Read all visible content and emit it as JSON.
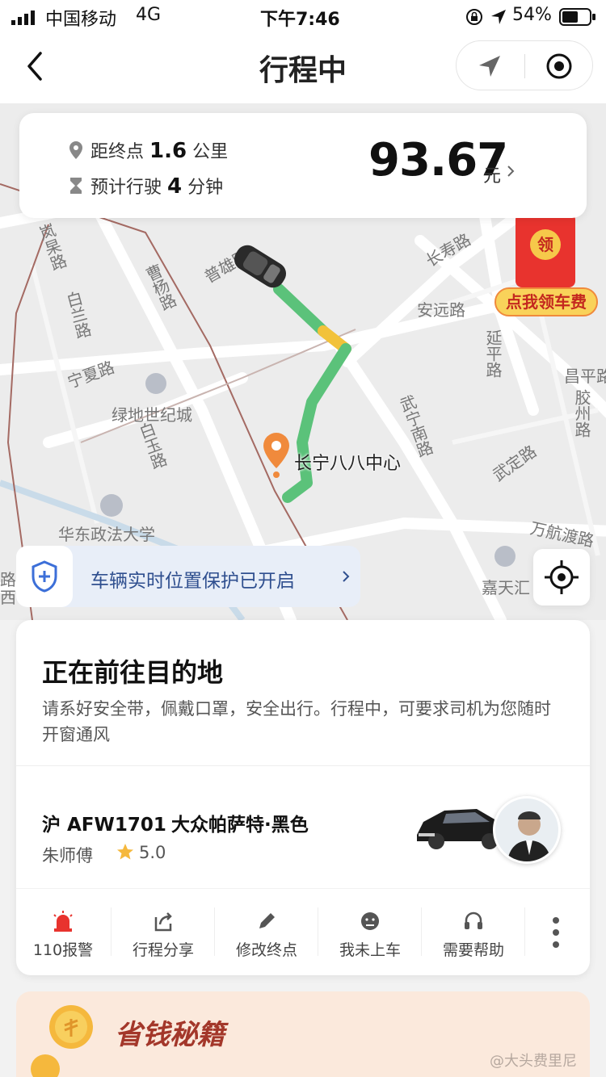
{
  "status_bar": {
    "carrier": "中国移动",
    "network": "4G",
    "time": "下午7:46",
    "battery": "54%"
  },
  "nav": {
    "title": "行程中"
  },
  "trip_info": {
    "distance_prefix": "距终点",
    "distance_value": "1.6",
    "distance_unit": "公里",
    "eta_prefix": "预计行驶",
    "eta_value": "4",
    "eta_unit": "分钟",
    "fare": "93.67",
    "fare_unit": "元"
  },
  "promo_badge": {
    "icon_text": "领",
    "label": "点我领车费"
  },
  "map": {
    "labels": [
      "长寿路",
      "安远路",
      "延平路",
      "昌平路",
      "胶州路",
      "武宁南路",
      "武定路",
      "万航渡路",
      "嘉天汇",
      "普雄路",
      "曹杨路",
      "白兰路",
      "宁夏路",
      "绿地世纪城",
      "白玉路",
      "华东政法大学",
      "岚杲路",
      "路",
      "西"
    ],
    "destination_name": "长宁八八中心"
  },
  "safety_banner": {
    "text": "车辆实时位置保护已开启"
  },
  "status_card": {
    "title": "正在前往目的地",
    "tip": "请系好安全带，佩戴口罩，安全出行。行程中，可要求司机为您随时开窗通风"
  },
  "driver": {
    "plate": "沪 AFW1701",
    "car": "大众帕萨特·黑色",
    "name": "朱师傅",
    "rating": "5.0"
  },
  "actions": [
    {
      "label": "110报警",
      "icon": "alarm-icon"
    },
    {
      "label": "行程分享",
      "icon": "share-icon"
    },
    {
      "label": "修改终点",
      "icon": "pencil-icon"
    },
    {
      "label": "我未上车",
      "icon": "face-icon"
    },
    {
      "label": "需要帮助",
      "icon": "headset-icon"
    }
  ],
  "bottom_banner": {
    "title": "省钱秘籍"
  },
  "watermark": "@大头费里尼",
  "colors": {
    "route_green": "#5bc27a",
    "route_yellow": "#f2c23a",
    "accent_orange": "#f08a3c",
    "promo_red": "#e8332e",
    "shield_blue": "#3c6fd8"
  }
}
